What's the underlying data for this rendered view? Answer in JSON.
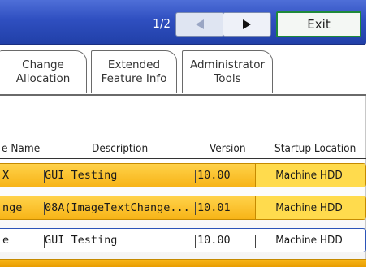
{
  "header": {
    "page_indicator": "1/2",
    "prev_icon": "triangle-left",
    "next_icon": "triangle-right",
    "exit_label": "Exit"
  },
  "tabs": [
    {
      "label": "Change\nAllocation"
    },
    {
      "label": "Extended\nFeature Info"
    },
    {
      "label": "Administrator\nTools"
    }
  ],
  "table": {
    "columns": {
      "name": "e Name",
      "description": "Description",
      "version": "Version",
      "location": "Startup Location"
    },
    "rows": [
      {
        "name": "X",
        "description": "GUI Testing",
        "version": "10.00",
        "location": "Machine HDD",
        "selected": true
      },
      {
        "name": "nge",
        "description": "08A(ImageTextChange...",
        "version": "10.01",
        "location": "Machine HDD",
        "selected": true
      },
      {
        "name": "e",
        "description": "GUI Testing",
        "version": "10.00",
        "location": "Machine HDD",
        "selected": false
      }
    ]
  },
  "colors": {
    "header_blue": "#2f4fc0",
    "selected_row": "#f7b417",
    "exit_border": "#1f8a3a"
  }
}
